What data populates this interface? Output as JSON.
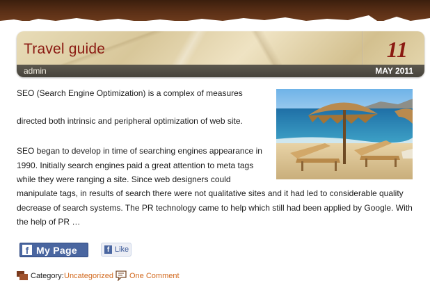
{
  "post": {
    "title": "Travel guide",
    "author": "admin",
    "date_day": "11",
    "date_month_year": "MAY 2011",
    "paragraphs": [
      "SEO (Search Engine Optimization) is a complex of measures",
      "directed both intrinsic and peripheral optimization of web site.",
      "SEO began to develop in time of searching engines appearance in 1990. Initially search engines paid a great attention to meta tags while they were ranging a site. Since web designers could",
      "manipulate tags, in results of search there were not qualitative sites and it had led to considerable quality decrease of search systems. The PR technology came to help which still had been applied by Google.  With the help of PR …"
    ]
  },
  "social": {
    "my_page_label": "My Page",
    "like_label": "Like"
  },
  "footer": {
    "category_label": "Category:",
    "category_value": "Uncategorized",
    "comments_link": "One Comment"
  },
  "colors": {
    "title": "#8b1a12",
    "link": "#d2691e",
    "facebook": "#4a66a0"
  },
  "icons": {
    "category": "category-icon",
    "comment": "comment-bubble-icon",
    "facebook": "facebook-f-icon"
  }
}
